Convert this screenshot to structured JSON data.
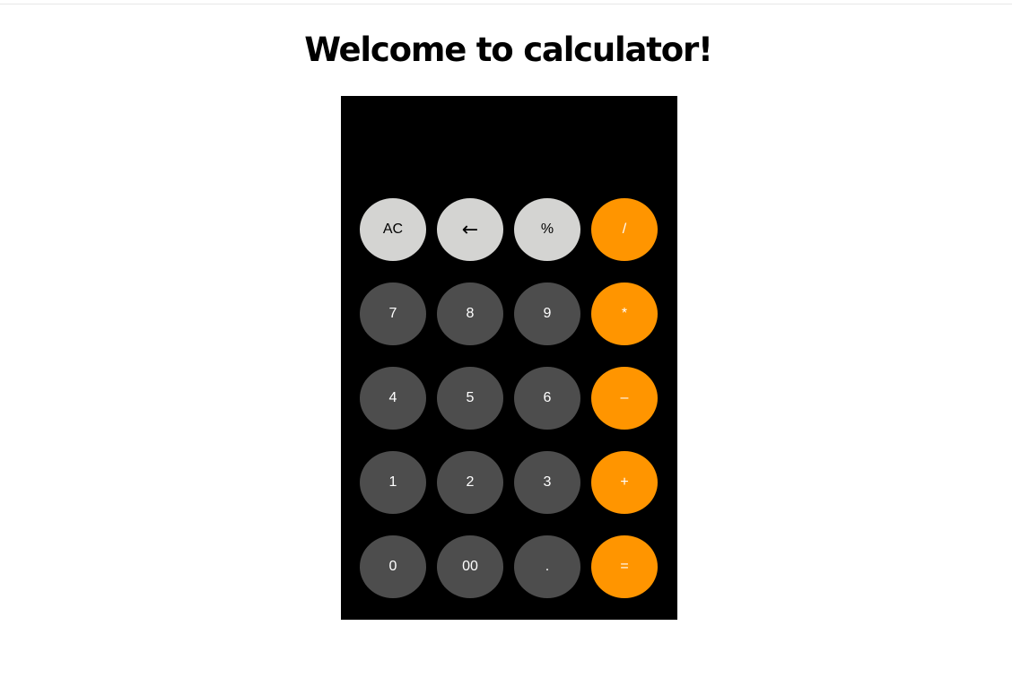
{
  "page": {
    "title": "Welcome to calculator!"
  },
  "display": {
    "value": ""
  },
  "colors": {
    "light_key": "#d4d4d2",
    "dark_key": "#4d4d4d",
    "operator_key": "#ff9500",
    "calculator_bg": "#000000"
  },
  "keys": {
    "row1": [
      "AC",
      "←",
      "%",
      "/"
    ],
    "row2": [
      "7",
      "8",
      "9",
      "*"
    ],
    "row3": [
      "4",
      "5",
      "6",
      "–"
    ],
    "row4": [
      "1",
      "2",
      "3",
      "+"
    ],
    "row5": [
      "0",
      "00",
      ".",
      "="
    ]
  }
}
